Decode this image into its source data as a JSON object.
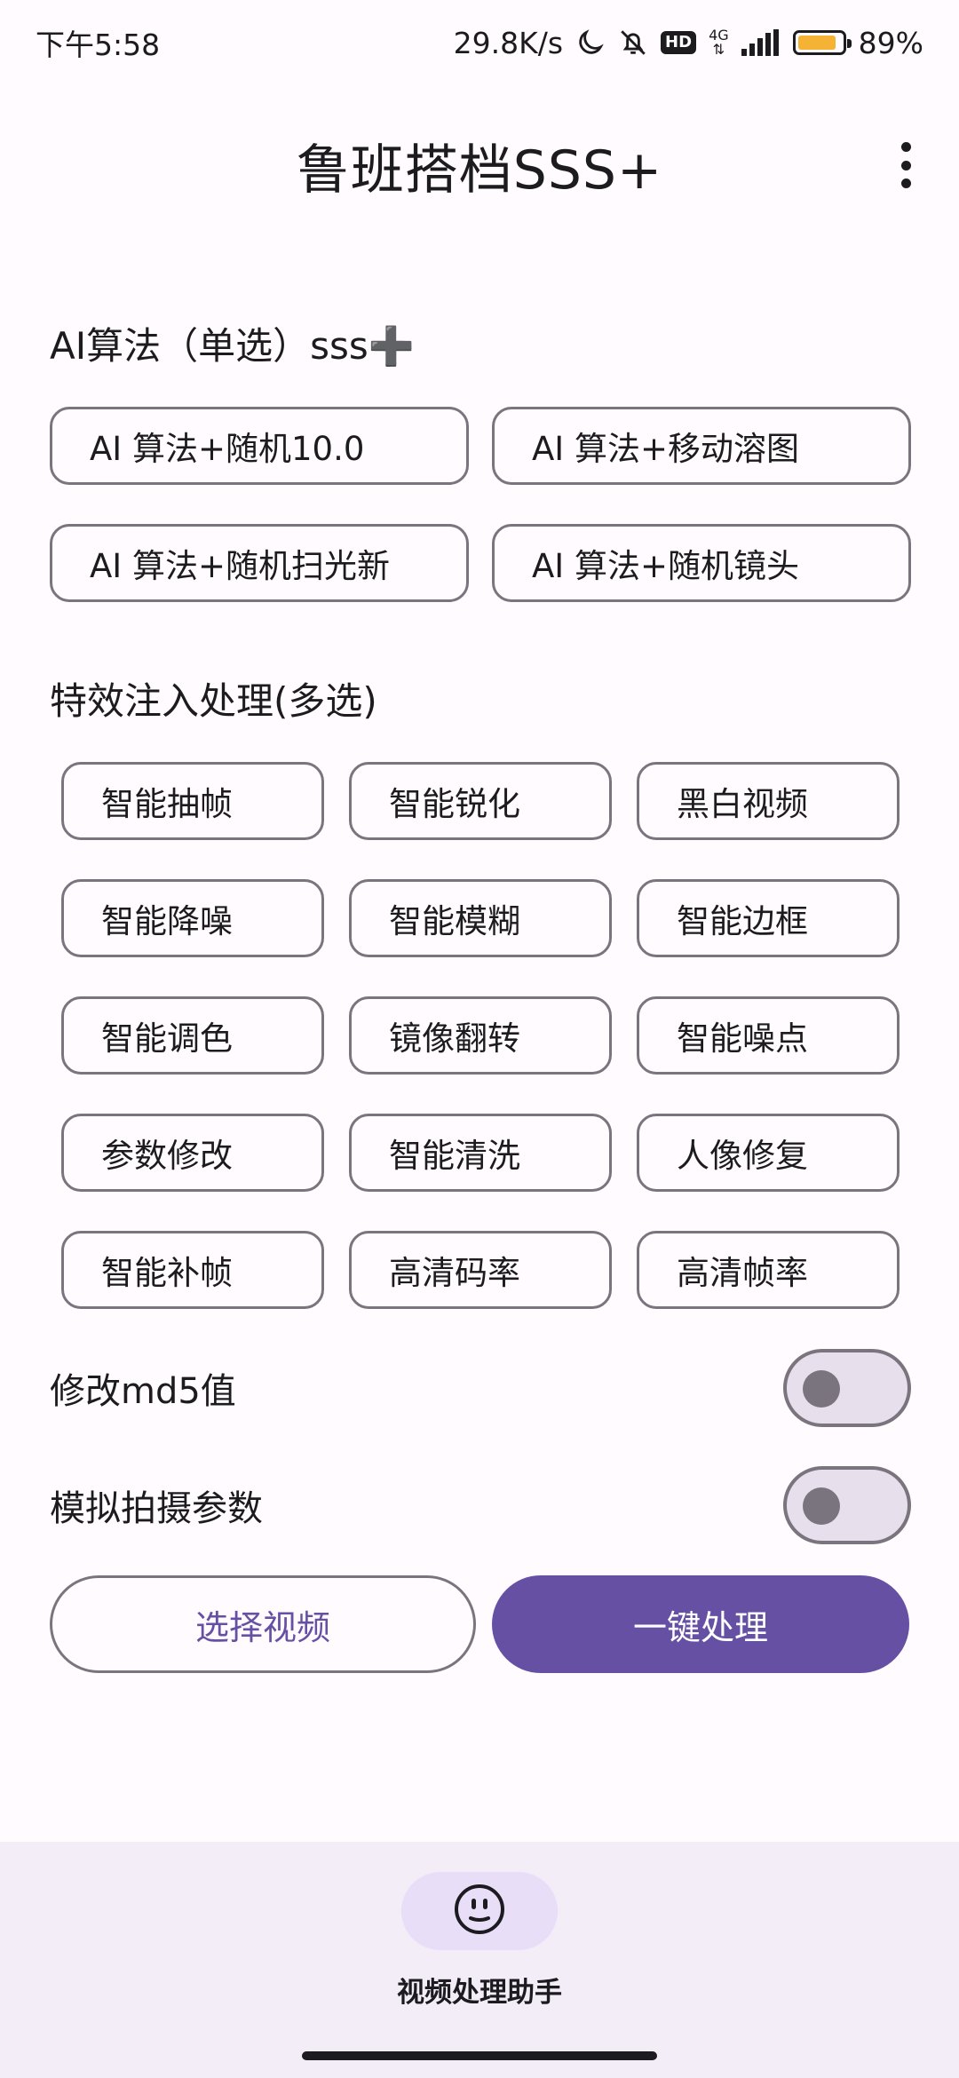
{
  "status_bar": {
    "time": "下午5:58",
    "net_speed": "29.8K/s",
    "hd": "HD",
    "network_type": "4G",
    "battery_percent": "89%",
    "battery_level": 0.89
  },
  "app_bar": {
    "title": "鲁班搭档SSS+"
  },
  "ai_section": {
    "title": "AI算法（单选）sss➕",
    "options": [
      "AI 算法+随机10.0",
      "AI 算法+移动溶图",
      "AI 算法+随机扫光新",
      "AI 算法+随机镜头"
    ]
  },
  "fx_section": {
    "title": "特效注入处理(多选)",
    "options": [
      "智能抽帧",
      "智能锐化",
      "黑白视频",
      "智能降噪",
      "智能模糊",
      "智能边框",
      "智能调色",
      "镜像翻转",
      "智能噪点",
      "参数修改",
      "智能清洗",
      "人像修复",
      "智能补帧",
      "高清码率",
      "高清帧率"
    ]
  },
  "switches": {
    "md5": {
      "label": "修改md5值",
      "checked": false
    },
    "camera": {
      "label": "模拟拍摄参数",
      "checked": false
    }
  },
  "actions": {
    "select_video": "选择视频",
    "process": "一键处理"
  },
  "bottom_nav": {
    "label": "视频处理助手",
    "icon": "smiley-face-icon"
  },
  "colors": {
    "primary": "#6650A4",
    "outline": "#79747E",
    "surface": "#FFFBFE",
    "nav_background": "#F3EDF7",
    "nav_indicator": "#E8DEF8",
    "battery": "#F5B335"
  }
}
